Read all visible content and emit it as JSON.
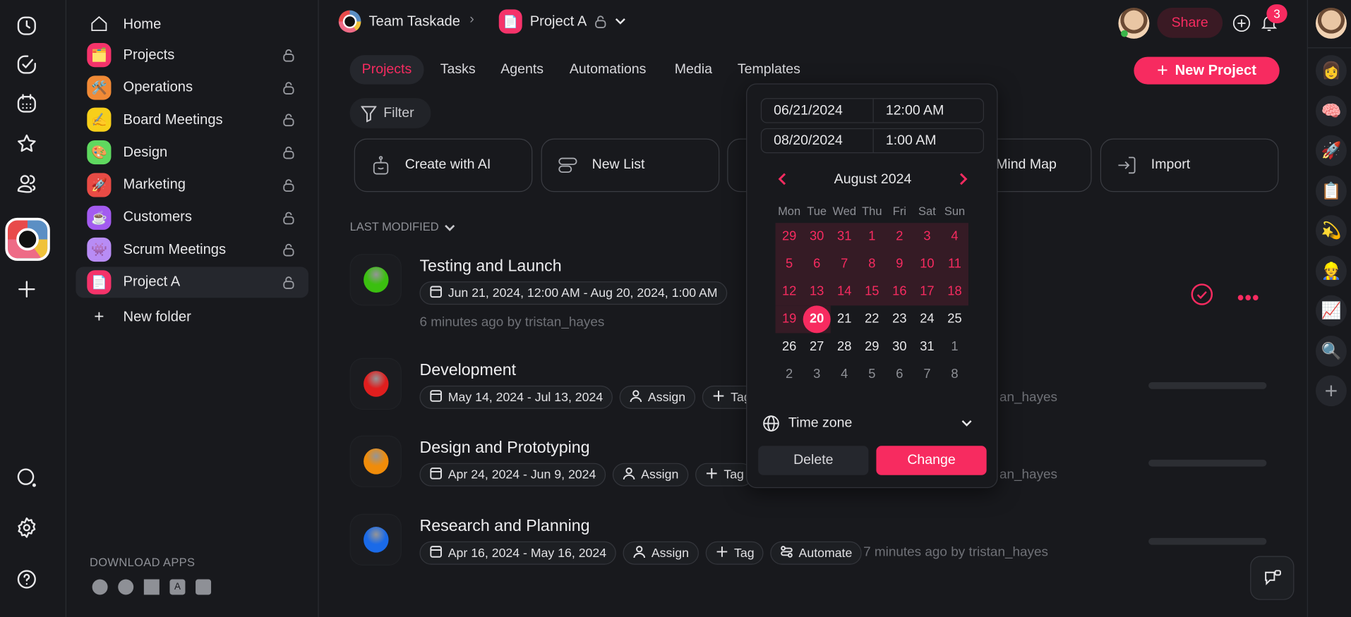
{
  "rail": {
    "icons": [
      "clock-icon",
      "check-circle-icon",
      "calendar-icon",
      "star-icon",
      "users-icon"
    ],
    "bottom_icons": [
      "search-icon",
      "gear-icon",
      "help-icon"
    ]
  },
  "sidebar": {
    "home": "Home",
    "items": [
      {
        "label": "Projects",
        "emoji": "🗂️",
        "color": "#f5336a"
      },
      {
        "label": "Operations",
        "emoji": "🛠️",
        "color": "#f08a36"
      },
      {
        "label": "Board Meetings",
        "emoji": "✍️",
        "color": "#f7cf1a"
      },
      {
        "label": "Design",
        "emoji": "🎨",
        "color": "#5fd85f"
      },
      {
        "label": "Marketing",
        "emoji": "🚀",
        "color": "#e84b45"
      },
      {
        "label": "Customers",
        "emoji": "☕",
        "color": "#a35bf0"
      },
      {
        "label": "Scrum Meetings",
        "emoji": "👾",
        "color": "#b88cf5"
      },
      {
        "label": "Project A",
        "emoji": "📄",
        "color": "#f5336a",
        "selected": true
      }
    ],
    "new_folder": "New folder",
    "download_title": "DOWNLOAD APPS",
    "apps": [
      "apple-icon",
      "chrome-icon",
      "windows-icon",
      "app-store-icon",
      "android-icon"
    ]
  },
  "header": {
    "workspace": "Team Taskade",
    "project": "Project A",
    "share": "Share",
    "notifications": "3"
  },
  "tabs": [
    "Projects",
    "Tasks",
    "Agents",
    "Automations",
    "Media",
    "Templates"
  ],
  "filter": "Filter",
  "new_project": "New Project",
  "cards": [
    "Create with AI",
    "New List",
    "",
    "Mind Map",
    "Import"
  ],
  "sort_label": "LAST MODIFIED",
  "projects": [
    {
      "title": "Testing and Launch",
      "dates": "Jun 21, 2024, 12:00 AM - Aug 20, 2024, 1:00 AM",
      "meta": "6 minutes ago by tristan_hayes",
      "color": "#3bbf10"
    },
    {
      "title": "Development",
      "dates": "May 14, 2024 - Jul 13, 2024",
      "assign": "Assign",
      "tag": "Tag",
      "meta": "an_hayes",
      "color": "#e01e1e"
    },
    {
      "title": "Design and Prototyping",
      "dates": "Apr 24, 2024 - Jun 9, 2024",
      "assign": "Assign",
      "tag": "Tag",
      "meta": "an_hayes",
      "color": "#f08c0a"
    },
    {
      "title": "Research and Planning",
      "dates": "Apr 16, 2024 - May 16, 2024",
      "assign": "Assign",
      "tag": "Tag",
      "automate": "Automate",
      "meta": "7 minutes ago by tristan_hayes",
      "color": "#1a6ae8"
    }
  ],
  "datepicker": {
    "start_date": "06/21/2024",
    "start_time": "12:00 AM",
    "end_date": "08/20/2024",
    "end_time": "1:00 AM",
    "month": "August 2024",
    "weekdays": [
      "Mon",
      "Tue",
      "Wed",
      "Thu",
      "Fri",
      "Sat",
      "Sun"
    ],
    "weeks": [
      [
        [
          "29",
          "range"
        ],
        [
          "30",
          "range"
        ],
        [
          "31",
          "range"
        ],
        [
          "1",
          "range"
        ],
        [
          "2",
          "range"
        ],
        [
          "3",
          "range"
        ],
        [
          "4",
          "range"
        ]
      ],
      [
        [
          "5",
          "range"
        ],
        [
          "6",
          "range"
        ],
        [
          "7",
          "range"
        ],
        [
          "8",
          "range"
        ],
        [
          "9",
          "range"
        ],
        [
          "10",
          "range"
        ],
        [
          "11",
          "range"
        ]
      ],
      [
        [
          "12",
          "range"
        ],
        [
          "13",
          "range"
        ],
        [
          "14",
          "range"
        ],
        [
          "15",
          "range"
        ],
        [
          "16",
          "range"
        ],
        [
          "17",
          "range"
        ],
        [
          "18",
          "range"
        ]
      ],
      [
        [
          "19",
          "range"
        ],
        [
          "20",
          "selected"
        ],
        [
          "21",
          "current"
        ],
        [
          "22",
          "current"
        ],
        [
          "23",
          "current"
        ],
        [
          "24",
          "current"
        ],
        [
          "25",
          "current"
        ]
      ],
      [
        [
          "26",
          "current"
        ],
        [
          "27",
          "current"
        ],
        [
          "28",
          "current"
        ],
        [
          "29",
          "current"
        ],
        [
          "30",
          "current"
        ],
        [
          "31",
          "current"
        ],
        [
          "1",
          "other"
        ]
      ],
      [
        [
          "2",
          "other"
        ],
        [
          "3",
          "other"
        ],
        [
          "4",
          "other"
        ],
        [
          "5",
          "other"
        ],
        [
          "6",
          "other"
        ],
        [
          "7",
          "other"
        ],
        [
          "8",
          "other"
        ]
      ]
    ],
    "timezone": "Time zone",
    "delete": "Delete",
    "change": "Change"
  },
  "right_rail": [
    "👩",
    "🧠",
    "🚀",
    "📋",
    "💫",
    "👷",
    "📈",
    "🔍"
  ],
  "colors": {
    "accent": "#f72b60",
    "bg": "#18191d",
    "range": "#351b25"
  }
}
